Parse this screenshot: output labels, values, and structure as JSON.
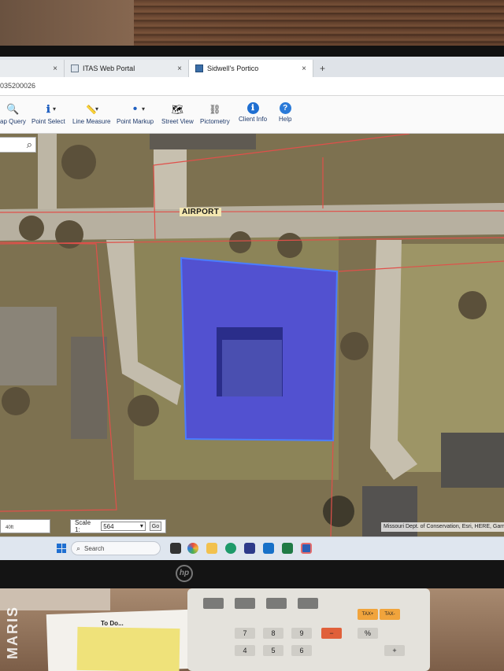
{
  "browser": {
    "tabs": [
      {
        "label": "",
        "active": false
      },
      {
        "label": "ITAS Web Portal",
        "active": false
      },
      {
        "label": "Sidwell's Portico",
        "active": true
      }
    ],
    "new_tab": "+",
    "close_glyph": "×",
    "address_text": "035200026"
  },
  "toolbar": {
    "items": [
      {
        "name": "map-query",
        "label": "ap Query",
        "icon": "magnifier-icon",
        "glyph": "🔍"
      },
      {
        "name": "point-select",
        "label": "Point Select",
        "icon": "info-point-icon",
        "glyph": "ℹ"
      },
      {
        "name": "line-measure",
        "label": "Line Measure",
        "icon": "ruler-icon",
        "glyph": "📏"
      },
      {
        "name": "point-markup",
        "label": "Point Markup",
        "icon": "dot-icon",
        "glyph": "•"
      },
      {
        "name": "street-view",
        "label": "Street View",
        "icon": "street-view-icon",
        "glyph": "🗺"
      },
      {
        "name": "pictometry",
        "label": "Pictometry",
        "icon": "pictometry-icon",
        "glyph": "⛓"
      },
      {
        "name": "client-info",
        "label": "Client Info",
        "icon": "client-info-icon",
        "glyph": "ℹ"
      },
      {
        "name": "help",
        "label": "Help",
        "icon": "help-icon",
        "glyph": "?"
      }
    ],
    "dropdown_caret": "▾"
  },
  "map": {
    "road_label": "AIRPORT",
    "search_icon": "search-icon",
    "parcel_highlight_color": "#3b3dff",
    "parcel_line_color": "#e0504a"
  },
  "statusbar": {
    "ruler_text": "40ft",
    "scale_label": "Scale 1:",
    "scale_value": "564",
    "go_label": "Go",
    "attribution": "Missouri Dept. of Conservation, Esri, HERE, Garmin"
  },
  "taskbar": {
    "search_placeholder": "Search"
  },
  "desk": {
    "monitor_brand": "hp",
    "note_text": "To Do...",
    "watermark": "MARIS",
    "calc_keys": [
      "7",
      "8",
      "9",
      "4",
      "5",
      "6",
      "%",
      "TAX+",
      "TAX-",
      "−",
      "+"
    ]
  }
}
